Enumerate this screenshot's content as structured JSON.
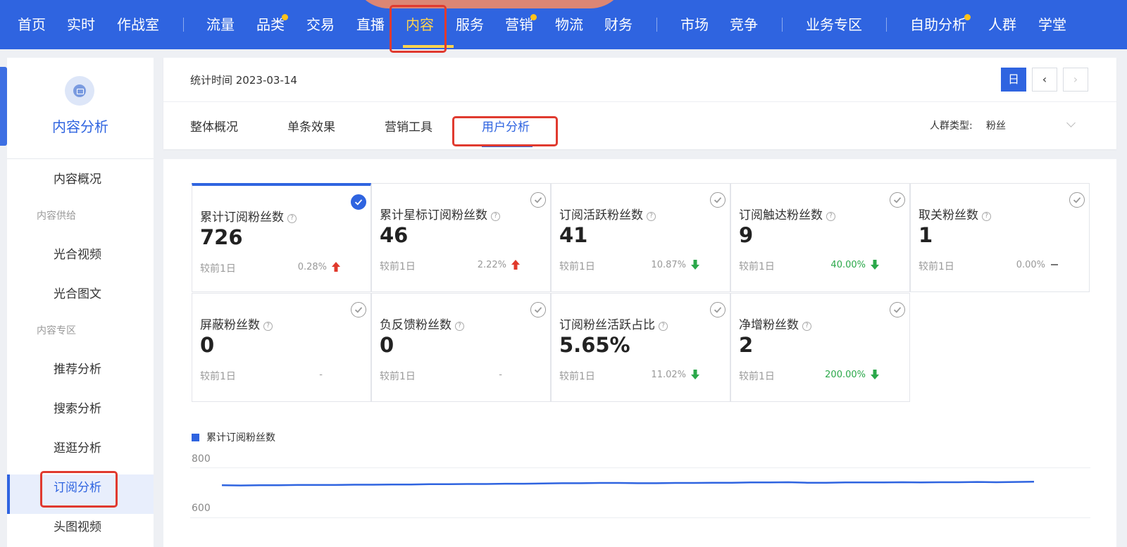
{
  "topnav": {
    "items": [
      {
        "label": "首页"
      },
      {
        "label": "实时"
      },
      {
        "label": "作战室"
      },
      {
        "label": "流量"
      },
      {
        "label": "品类"
      },
      {
        "label": "交易"
      },
      {
        "label": "直播"
      },
      {
        "label": "内容"
      },
      {
        "label": "服务"
      },
      {
        "label": "营销"
      },
      {
        "label": "物流"
      },
      {
        "label": "财务"
      },
      {
        "label": "市场"
      },
      {
        "label": "竞争"
      },
      {
        "label": "业务专区"
      },
      {
        "label": "自助分析"
      },
      {
        "label": "人群"
      },
      {
        "label": "学堂"
      }
    ],
    "active": "内容"
  },
  "sidebar": {
    "title": "内容分析",
    "items": [
      {
        "label": "内容概况"
      },
      {
        "label": "内容供给"
      },
      {
        "label": "光合视频"
      },
      {
        "label": "光合图文"
      },
      {
        "label": "内容专区"
      },
      {
        "label": "推荐分析"
      },
      {
        "label": "搜索分析"
      },
      {
        "label": "逛逛分析"
      },
      {
        "label": "订阅分析"
      },
      {
        "label": "头图视频"
      }
    ],
    "active": "订阅分析"
  },
  "header": {
    "stat_time": "统计时间 2023-03-14",
    "day_button": "日",
    "prev_button": "‹",
    "next_button": "›",
    "tabs": [
      {
        "label": "整体概况"
      },
      {
        "label": "单条效果"
      },
      {
        "label": "营销工具"
      },
      {
        "label": "用户分析"
      }
    ],
    "active_tab": "用户分析",
    "crowd_label": "人群类型:",
    "crowd_value": "粉丝"
  },
  "metrics": [
    {
      "name": "累计订阅粉丝数",
      "value": "726",
      "compare": "较前1日",
      "change": "0.28%",
      "trend": "up",
      "selected": true
    },
    {
      "name": "累计星标订阅粉丝数",
      "value": "46",
      "compare": "较前1日",
      "change": "2.22%",
      "trend": "up",
      "selected": false
    },
    {
      "name": "订阅活跃粉丝数",
      "value": "41",
      "compare": "较前1日",
      "change": "10.87%",
      "trend": "down",
      "selected": false
    },
    {
      "name": "订阅触达粉丝数",
      "value": "9",
      "compare": "较前1日",
      "change": "40.00%",
      "trend": "down",
      "selected": false
    },
    {
      "name": "取关粉丝数",
      "value": "1",
      "compare": "较前1日",
      "change": "0.00%",
      "trend": "flat",
      "selected": false
    },
    {
      "name": "屏蔽粉丝数",
      "value": "0",
      "compare": "较前1日",
      "change": "-",
      "trend": "none",
      "selected": false
    },
    {
      "name": "负反馈粉丝数",
      "value": "0",
      "compare": "较前1日",
      "change": "-",
      "trend": "none",
      "selected": false
    },
    {
      "name": "订阅粉丝活跃占比",
      "value": "5.65%",
      "compare": "较前1日",
      "change": "11.02%",
      "trend": "down",
      "selected": false
    },
    {
      "name": "净增粉丝数",
      "value": "2",
      "compare": "较前1日",
      "change": "200.00%",
      "trend": "down",
      "selected": false
    }
  ],
  "colors": {
    "primary": "#2f64e0",
    "up": "#e0392b",
    "down": "#2ba84a",
    "highlight": "#e03a2f"
  },
  "chart_data": {
    "type": "line",
    "series": [
      {
        "name": "累计订阅粉丝数",
        "values": [
          712,
          711,
          712,
          712,
          713,
          713,
          713,
          714,
          714,
          715,
          715,
          716,
          716,
          717,
          717,
          718,
          718,
          719,
          720,
          720,
          721,
          721,
          720,
          720,
          721,
          721,
          722,
          722,
          723,
          723,
          724,
          722,
          722,
          723,
          723,
          723,
          724,
          723,
          724,
          724,
          725,
          724,
          725,
          726
        ]
      }
    ],
    "yticks": [
      600,
      800
    ],
    "ylim": [
      600,
      800
    ]
  }
}
